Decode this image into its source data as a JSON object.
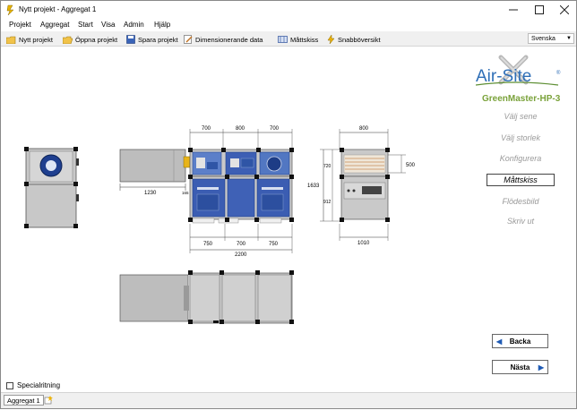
{
  "window": {
    "title": "Nytt projekt - Aggregat 1"
  },
  "menu": [
    "Projekt",
    "Aggregat",
    "Start",
    "Visa",
    "Admin",
    "Hjälp"
  ],
  "toolbar": {
    "new_project": "Nytt projekt",
    "open_project": "Öppna projekt",
    "save_project": "Spara projekt",
    "dimension_data": "Dimensionerande data",
    "dimension_sketch": "Måttskiss",
    "quick_overview": "Snabböversikt"
  },
  "language": "Svenska",
  "logo": {
    "text": "Air-Site",
    "reg": "®"
  },
  "model": "GreenMaster-HP-3",
  "steps": [
    "Välj sene",
    "Välj storlek",
    "Konfigurera",
    "Måttskiss",
    "Flödesbild",
    "Skriv ut"
  ],
  "active_step": "Måttskiss",
  "nav": {
    "back": "Backa",
    "next": "Nästa"
  },
  "special_drawing": {
    "label": "Specialritning",
    "checked": false
  },
  "status_tabs": [
    "Aggregat 1"
  ],
  "dimensions": {
    "top_widths": [
      "700",
      "800",
      "700"
    ],
    "bottom_widths": [
      "750",
      "700",
      "750"
    ],
    "total_length": "2200",
    "duct_length": "1230",
    "small_dim": "165",
    "end_width": "800",
    "end_height_total": "1633",
    "end_upper": "720",
    "end_lower": "912",
    "end_opening": "500",
    "end_bottom_width": "1010"
  },
  "colors": {
    "casing": "#c8c8c8",
    "panel_blue": "#3d5fb4",
    "accent_green": "#7aa23a",
    "logo_blue": "#2f6fb7",
    "logo_green": "#5e8f34"
  }
}
